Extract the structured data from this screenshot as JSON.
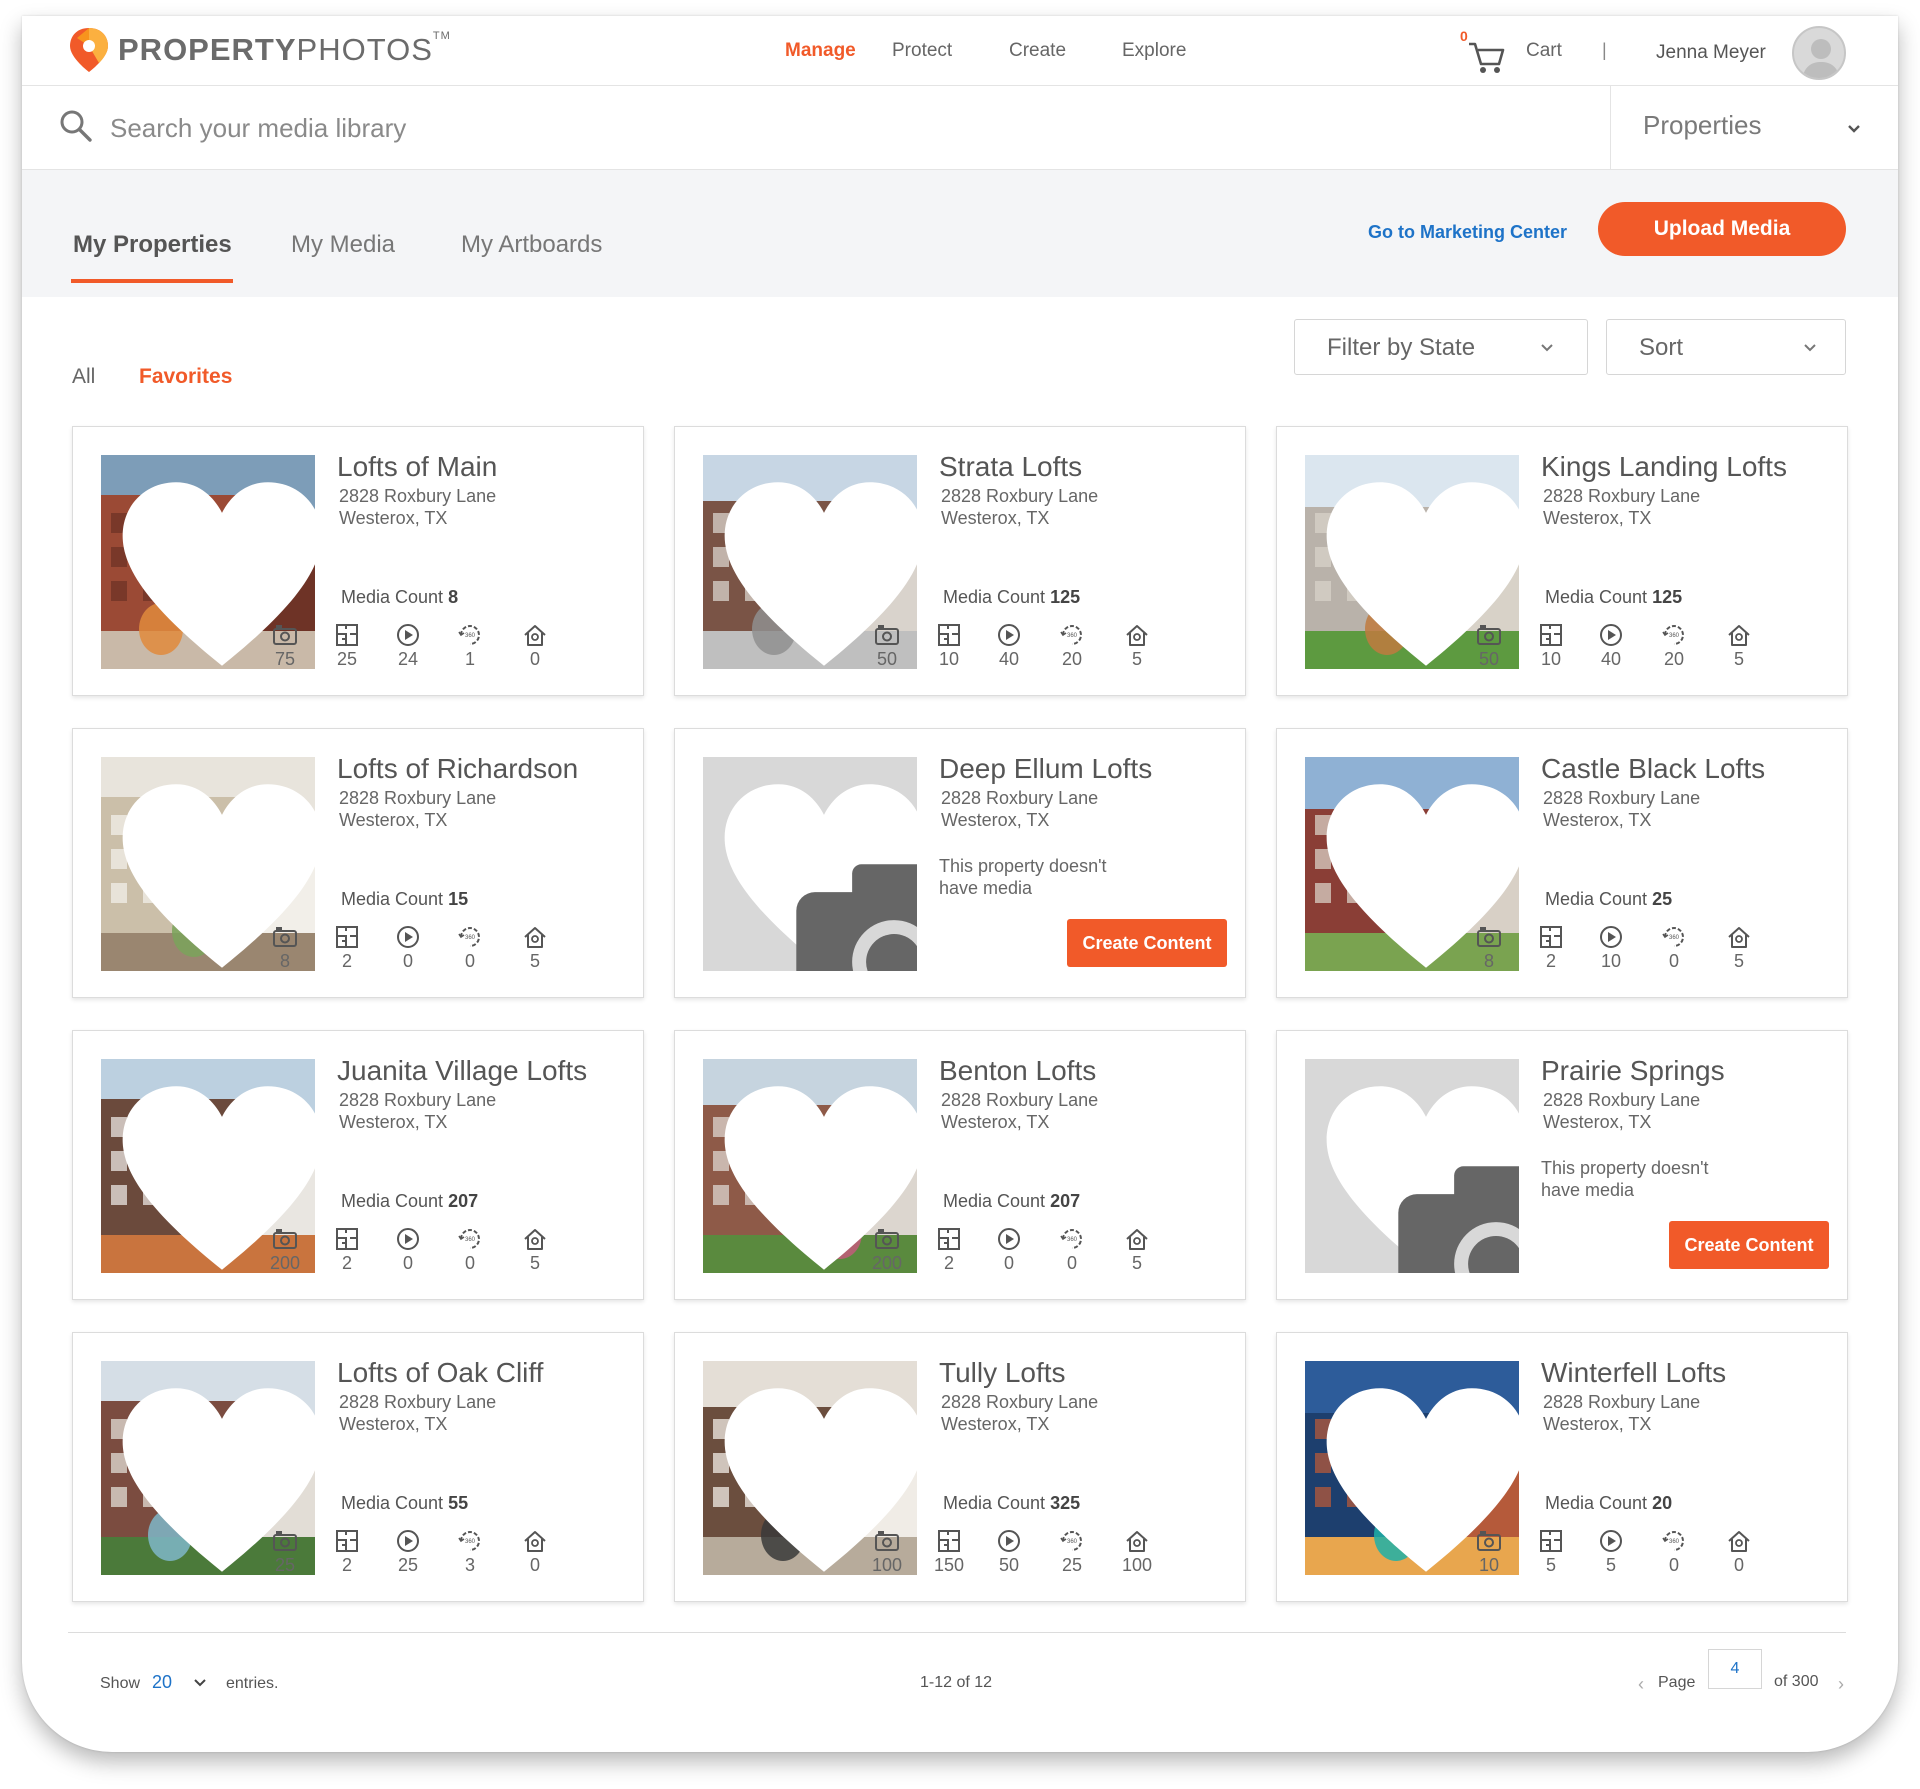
{
  "brand": {
    "name_bold": "PROPERTY",
    "name_light": "PHOTOS",
    "tm": "TM",
    "accent": "#f15a29",
    "link": "#1e73c8"
  },
  "nav": {
    "manage": "Manage",
    "protect": "Protect",
    "create": "Create",
    "explore": "Explore",
    "cart": "Cart",
    "cart_count": "0",
    "separator": "|",
    "user": "Jenna Meyer"
  },
  "search": {
    "placeholder": "Search your media library",
    "scope": "Properties"
  },
  "tabs": {
    "properties": "My Properties",
    "media": "My Media",
    "artboards": "My Artboards"
  },
  "actions": {
    "marketing": "Go to Marketing Center",
    "upload": "Upload Media"
  },
  "filters": {
    "all": "All",
    "favorites": "Favorites",
    "state": "Filter by State",
    "sort": "Sort"
  },
  "labels": {
    "media_count": "Media Count",
    "no_media_line1": "This property doesn't",
    "no_media_line2": "have media",
    "create_content": "Create Content"
  },
  "properties": [
    {
      "name": "Lofts of Main",
      "street": "2828 Roxbury Lane",
      "city": "Westerox, TX",
      "count": "8",
      "photos": "75",
      "floorplans": "25",
      "videos": "24",
      "tours": "1",
      "virtual": "0"
    },
    {
      "name": "Strata Lofts",
      "street": "2828 Roxbury Lane",
      "city": "Westerox, TX",
      "count": "125",
      "photos": "50",
      "floorplans": "10",
      "videos": "40",
      "tours": "20",
      "virtual": "5"
    },
    {
      "name": "Kings Landing Lofts",
      "street": "2828 Roxbury Lane",
      "city": "Westerox, TX",
      "count": "125",
      "photos": "50",
      "floorplans": "10",
      "videos": "40",
      "tours": "20",
      "virtual": "5"
    },
    {
      "name": "Lofts of Richardson",
      "street": "2828 Roxbury Lane",
      "city": "Westerox, TX",
      "count": "15",
      "photos": "8",
      "floorplans": "2",
      "videos": "0",
      "tours": "0",
      "virtual": "5"
    },
    {
      "name": "Deep Ellum Lofts",
      "street": "2828 Roxbury Lane",
      "city": "Westerox, TX"
    },
    {
      "name": "Castle Black Lofts",
      "street": "2828 Roxbury Lane",
      "city": "Westerox, TX",
      "count": "25",
      "photos": "8",
      "floorplans": "2",
      "videos": "10",
      "tours": "0",
      "virtual": "5"
    },
    {
      "name": "Juanita Village Lofts",
      "street": "2828 Roxbury Lane",
      "city": "Westerox, TX",
      "count": "207",
      "photos": "200",
      "floorplans": "2",
      "videos": "0",
      "tours": "0",
      "virtual": "5"
    },
    {
      "name": "Benton Lofts",
      "street": "2828 Roxbury Lane",
      "city": "Westerox, TX",
      "count": "207",
      "photos": "200",
      "floorplans": "2",
      "videos": "0",
      "tours": "0",
      "virtual": "5"
    },
    {
      "name": "Prairie Springs",
      "street": "2828 Roxbury Lane",
      "city": "Westerox, TX"
    },
    {
      "name": "Lofts of Oak Cliff",
      "street": "2828 Roxbury Lane",
      "city": "Westerox, TX",
      "count": "55",
      "photos": "25",
      "floorplans": "2",
      "videos": "25",
      "tours": "3",
      "virtual": "0"
    },
    {
      "name": "Tully Lofts",
      "street": "2828 Roxbury Lane",
      "city": "Westerox, TX",
      "count": "325",
      "photos": "100",
      "floorplans": "150",
      "videos": "50",
      "tours": "25",
      "virtual": "100"
    },
    {
      "name": "Winterfell Lofts",
      "street": "2828 Roxbury Lane",
      "city": "Westerox, TX",
      "count": "20",
      "photos": "10",
      "floorplans": "5",
      "videos": "5",
      "tours": "0",
      "virtual": "0"
    }
  ],
  "pagination": {
    "show": "Show",
    "per_page": "20",
    "entries": "entries.",
    "range": "1-12 of 12",
    "page_label": "Page",
    "page": "4",
    "of": "of  300"
  }
}
